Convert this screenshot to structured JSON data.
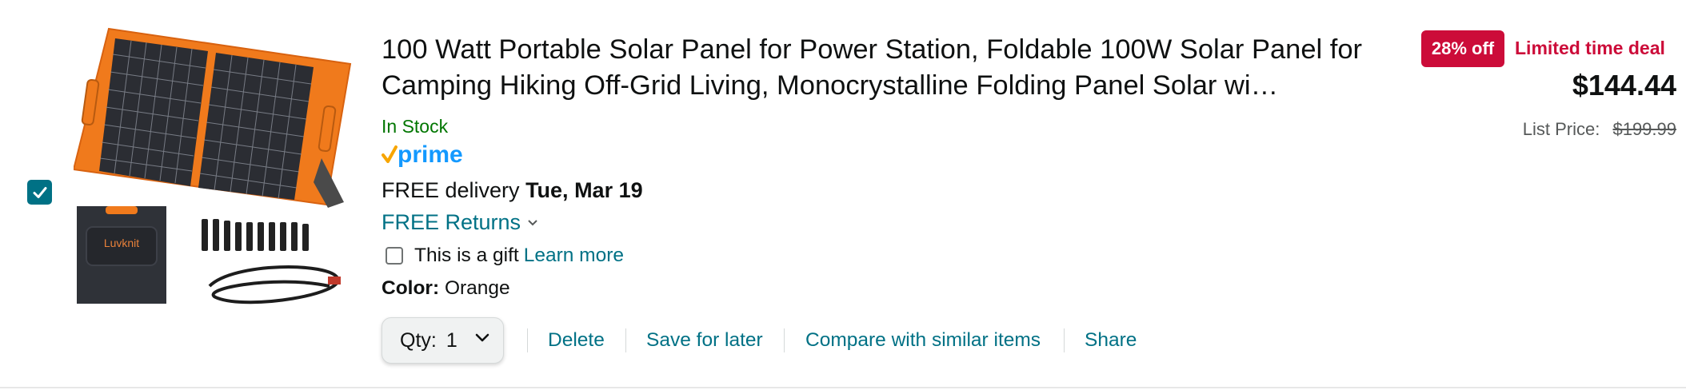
{
  "item": {
    "selected": true,
    "image_alt": "Luvknit",
    "title": "100 Watt Portable Solar Panel for Power Station, Foldable 100W Solar Panel for Camping Hiking Off-Grid Living, Monocrystalline Folding Panel Solar wi…",
    "stock": "In Stock",
    "prime_label": "prime",
    "delivery_prefix": "FREE delivery",
    "delivery_date": "Tue, Mar 19",
    "returns_label": "FREE Returns",
    "gift_label": "This is a gift",
    "gift_link": "Learn more",
    "color_label": "Color:",
    "color_value": "Orange"
  },
  "actions": {
    "qty_label": "Qty:",
    "qty_value": "1",
    "delete": "Delete",
    "save_for_later": "Save for later",
    "compare": "Compare with similar items",
    "share": "Share"
  },
  "pricing": {
    "deal_badge": "28% off",
    "deal_text": "Limited time deal",
    "price": "$144.44",
    "list_price_label": "List Price:",
    "list_price": "$199.99"
  },
  "colors": {
    "link": "#007185",
    "in_stock": "#007600",
    "deal_red": "#cc0c39",
    "prime_blue": "#1399ff",
    "prime_check": "#f7a500",
    "panel_orange": "#f07a1c"
  }
}
